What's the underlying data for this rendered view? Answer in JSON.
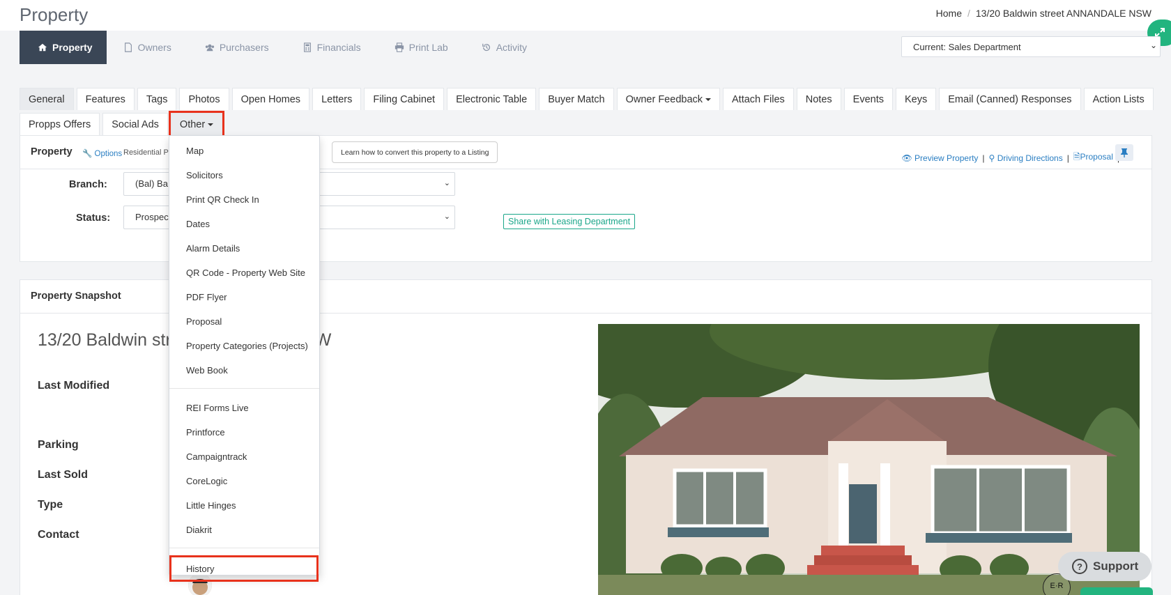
{
  "header": {
    "title": "Property",
    "breadcrumb": [
      "Home",
      "13/20 Baldwin street ANNANDALE NSW"
    ]
  },
  "main_nav": [
    {
      "label": "Property",
      "icon": "home-icon",
      "active": true
    },
    {
      "label": "Owners",
      "icon": "file-icon"
    },
    {
      "label": "Purchasers",
      "icon": "users-icon"
    },
    {
      "label": "Financials",
      "icon": "calculator-icon"
    },
    {
      "label": "Print Lab",
      "icon": "printer-icon"
    },
    {
      "label": "Activity",
      "icon": "history-icon"
    }
  ],
  "department_select": {
    "value": "Current: Sales Department"
  },
  "tabs_row1": [
    "General",
    "Features",
    "Tags",
    "Photos",
    "Open Homes",
    "Letters",
    "Filing Cabinet",
    "Electronic Table",
    "Buyer Match",
    "Owner Feedback",
    "Attach Files",
    "Notes",
    "Events",
    "Keys",
    "Email (Canned) Responses",
    "Action Lists"
  ],
  "tabs_row2": [
    "Propps Offers",
    "Social Ads",
    "Other"
  ],
  "property_panel": {
    "title": "Property",
    "options_label": "Options",
    "subtitle": "Residential Pr",
    "learn_button": "Learn how to convert this property to a Listing",
    "links": [
      "Preview Property",
      "Driving Directions",
      "Proposal"
    ],
    "branch_label": "Branch:",
    "branch_value": "(Bal) Ba",
    "status_label": "Status:",
    "status_value": "Prospec",
    "share_button": "Share with Leasing Department"
  },
  "snapshot": {
    "title": "Property Snapshot",
    "address_start": "13/20 Baldwin str",
    "address_end": "W",
    "labels": [
      "Last Modified",
      "Parking",
      "Last Sold",
      "Type",
      "Contact"
    ]
  },
  "other_menu": {
    "group1": [
      "Map",
      "Solicitors",
      "Print QR Check In",
      "Dates",
      "Alarm Details",
      "QR Code - Property Web Site",
      "PDF Flyer",
      "Proposal",
      "Property Categories (Projects)",
      "Web Book"
    ],
    "group2": [
      "REI Forms Live",
      "Printforce",
      "Campaigntrack",
      "CoreLogic",
      "Little Hinges",
      "Diakrit"
    ],
    "group3": [
      "History"
    ]
  },
  "support": {
    "label": "Support"
  },
  "badge": {
    "text": "E·R"
  },
  "colors": {
    "nav_active": "#3a4656",
    "highlight": "#e8321c",
    "accent_green": "#22b47f",
    "link": "#2a7ec2"
  }
}
